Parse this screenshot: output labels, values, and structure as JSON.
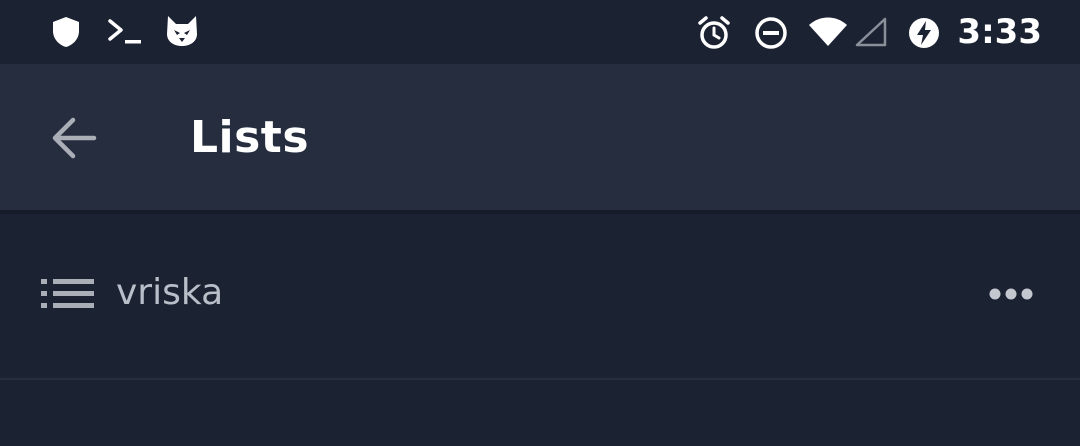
{
  "status_bar": {
    "time": "3:33",
    "left_icons": [
      "shield-icon",
      "terminal-icon",
      "husky-icon"
    ],
    "right_icons": [
      "alarm-icon",
      "do-not-disturb-icon",
      "wifi-icon",
      "cell-signal-icon",
      "battery-saver-icon"
    ]
  },
  "app_bar": {
    "title": "Lists",
    "back_icon": "arrow-left-icon"
  },
  "lists": [
    {
      "label": "vriska",
      "icon": "list-icon",
      "menu_icon": "more-horizontal-icon"
    }
  ],
  "colors": {
    "background": "#1b2232",
    "app_bar": "#252d3e",
    "title": "#ffffff",
    "item_text": "#b9bfc9",
    "icon_muted": "#a9aeb7"
  }
}
